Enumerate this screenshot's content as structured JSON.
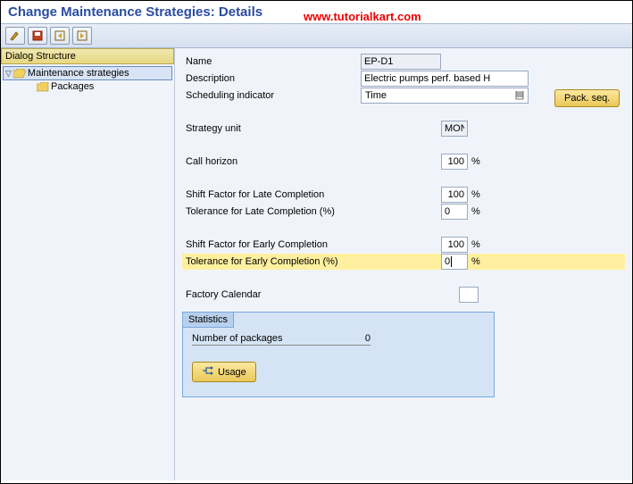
{
  "header": {
    "title": "Change Maintenance Strategies: Details",
    "watermark": "www.tutorialkart.com"
  },
  "tree": {
    "header": "Dialog Structure",
    "item1": "Maintenance strategies",
    "item2": "Packages"
  },
  "fields": {
    "name_label": "Name",
    "name_value": "EP-D1",
    "desc_label": "Description",
    "desc_value": "Electric pumps perf. based H",
    "sched_label": "Scheduling indicator",
    "sched_value": "Time",
    "unit_label": "Strategy unit",
    "unit_value": "MON",
    "horizon_label": "Call horizon",
    "horizon_value": "100",
    "late_sf_label": "Shift Factor for Late Completion",
    "late_sf_value": "100",
    "late_tol_label": "Tolerance for Late Completion (%)",
    "late_tol_value": "0",
    "early_sf_label": "Shift Factor for Early Completion",
    "early_sf_value": "100",
    "early_tol_label": "Tolerance for Early Completion (%)",
    "early_tol_value": "0",
    "cal_label": "Factory Calendar",
    "cal_value": "",
    "pct": "%"
  },
  "stats": {
    "title": "Statistics",
    "pkg_label": "Number of packages",
    "pkg_value": "0",
    "usage_btn": "Usage"
  },
  "buttons": {
    "pack_seq": "Pack. seq."
  }
}
